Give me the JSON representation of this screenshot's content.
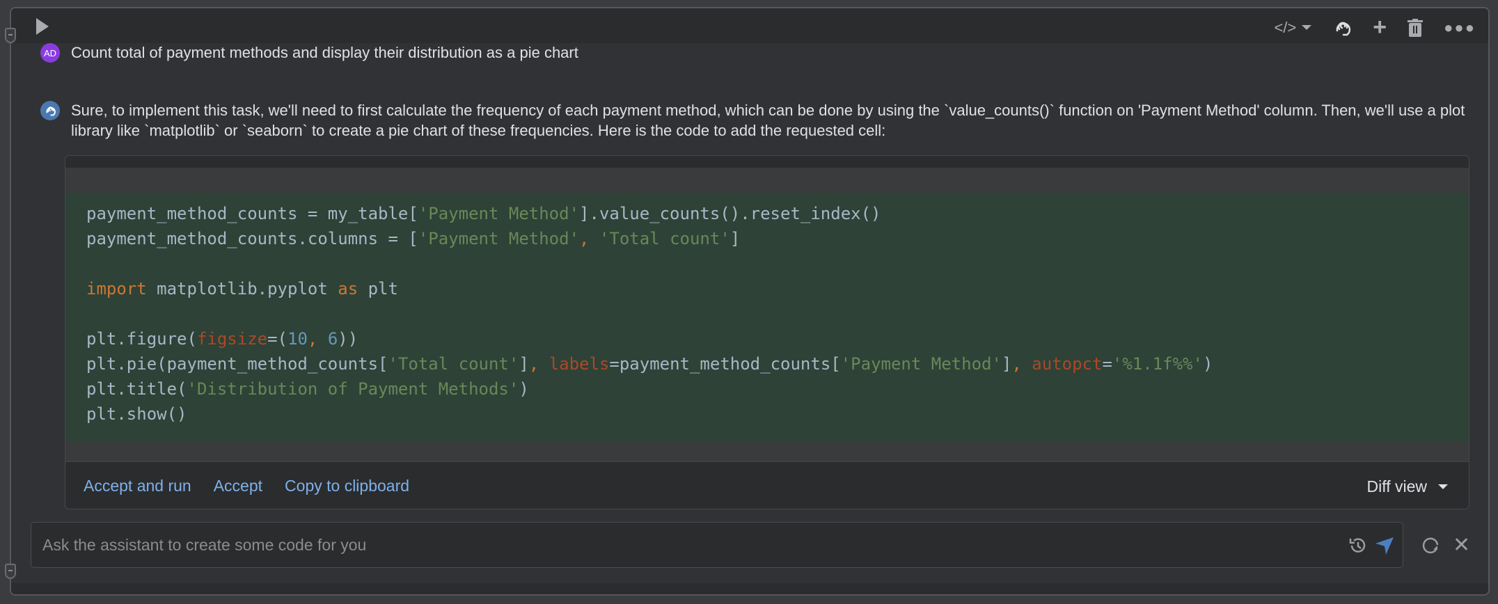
{
  "toolbar": {
    "run": "play-icon",
    "icons": [
      "code-icon",
      "assistant-icon",
      "plus-icon",
      "trash-icon",
      "more-icon"
    ]
  },
  "conversation": {
    "user": {
      "initials": "AD",
      "avatar_color": "#8a3ce0",
      "text": "Count total of payment methods and display their distribution as a pie chart"
    },
    "assistant": {
      "avatar_color": "#4a78b0",
      "text": "Sure, to implement this task, we'll need to first calculate the frequency of each payment method, which can be done by using the `value_counts()` function on 'Payment Method' column. Then, we'll use a plot library like `matplotlib` or `seaborn` to create a pie chart of these frequencies. Here is the code to add the requested cell:"
    }
  },
  "code": {
    "lines": [
      [
        [
          "t",
          "payment_method_counts = my_table["
        ],
        [
          "s",
          "'Payment Method'"
        ],
        [
          "t",
          "].value_counts().reset_index()"
        ]
      ],
      [
        [
          "t",
          "payment_method_counts.columns = ["
        ],
        [
          "s",
          "'Payment Method'"
        ],
        [
          "k",
          ", "
        ],
        [
          "s",
          "'Total count'"
        ],
        [
          "t",
          "]"
        ]
      ],
      [],
      [
        [
          "k",
          "import"
        ],
        [
          "t",
          " matplotlib.pyplot "
        ],
        [
          "k",
          "as"
        ],
        [
          "t",
          " plt"
        ]
      ],
      [],
      [
        [
          "t",
          "plt.figure("
        ],
        [
          "p",
          "figsize"
        ],
        [
          "t",
          "=("
        ],
        [
          "n",
          "10"
        ],
        [
          "k",
          ", "
        ],
        [
          "n",
          "6"
        ],
        [
          "t",
          "))"
        ]
      ],
      [
        [
          "t",
          "plt.pie(payment_method_counts["
        ],
        [
          "s",
          "'Total count'"
        ],
        [
          "t",
          "]"
        ],
        [
          "k",
          ", "
        ],
        [
          "p",
          "labels"
        ],
        [
          "t",
          "=payment_method_counts["
        ],
        [
          "s",
          "'Payment Method'"
        ],
        [
          "t",
          "]"
        ],
        [
          "k",
          ", "
        ],
        [
          "p",
          "autopct"
        ],
        [
          "t",
          "="
        ],
        [
          "s",
          "'%1.1f%%'"
        ],
        [
          "t",
          ")"
        ]
      ],
      [
        [
          "t",
          "plt.title("
        ],
        [
          "s",
          "'Distribution of Payment Methods'"
        ],
        [
          "t",
          ")"
        ]
      ],
      [
        [
          "t",
          "plt.show()"
        ]
      ]
    ]
  },
  "footer": {
    "accept_run": "Accept and run",
    "accept": "Accept",
    "copy": "Copy to clipboard",
    "view": "Diff view"
  },
  "input": {
    "placeholder": "Ask the assistant to create some code for you"
  }
}
